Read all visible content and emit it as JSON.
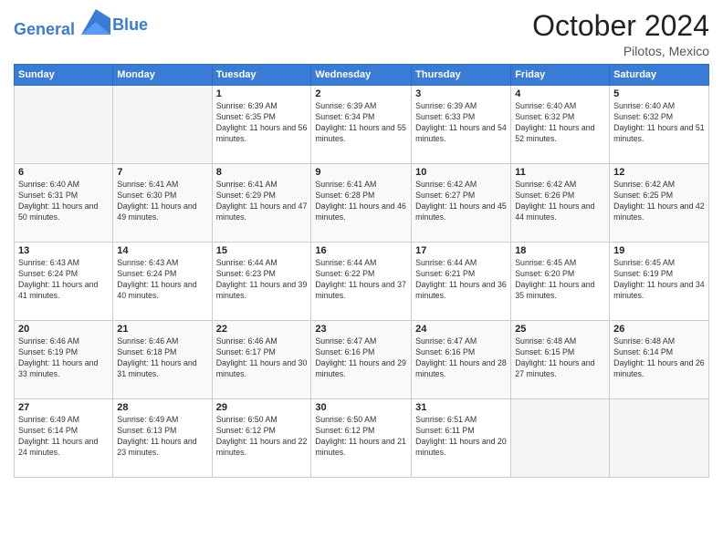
{
  "header": {
    "logo_line1": "General",
    "logo_line2": "Blue",
    "month": "October 2024",
    "location": "Pilotos, Mexico"
  },
  "weekdays": [
    "Sunday",
    "Monday",
    "Tuesday",
    "Wednesday",
    "Thursday",
    "Friday",
    "Saturday"
  ],
  "weeks": [
    [
      {
        "day": "",
        "info": ""
      },
      {
        "day": "",
        "info": ""
      },
      {
        "day": "1",
        "info": "Sunrise: 6:39 AM\nSunset: 6:35 PM\nDaylight: 11 hours and 56 minutes."
      },
      {
        "day": "2",
        "info": "Sunrise: 6:39 AM\nSunset: 6:34 PM\nDaylight: 11 hours and 55 minutes."
      },
      {
        "day": "3",
        "info": "Sunrise: 6:39 AM\nSunset: 6:33 PM\nDaylight: 11 hours and 54 minutes."
      },
      {
        "day": "4",
        "info": "Sunrise: 6:40 AM\nSunset: 6:32 PM\nDaylight: 11 hours and 52 minutes."
      },
      {
        "day": "5",
        "info": "Sunrise: 6:40 AM\nSunset: 6:32 PM\nDaylight: 11 hours and 51 minutes."
      }
    ],
    [
      {
        "day": "6",
        "info": "Sunrise: 6:40 AM\nSunset: 6:31 PM\nDaylight: 11 hours and 50 minutes."
      },
      {
        "day": "7",
        "info": "Sunrise: 6:41 AM\nSunset: 6:30 PM\nDaylight: 11 hours and 49 minutes."
      },
      {
        "day": "8",
        "info": "Sunrise: 6:41 AM\nSunset: 6:29 PM\nDaylight: 11 hours and 47 minutes."
      },
      {
        "day": "9",
        "info": "Sunrise: 6:41 AM\nSunset: 6:28 PM\nDaylight: 11 hours and 46 minutes."
      },
      {
        "day": "10",
        "info": "Sunrise: 6:42 AM\nSunset: 6:27 PM\nDaylight: 11 hours and 45 minutes."
      },
      {
        "day": "11",
        "info": "Sunrise: 6:42 AM\nSunset: 6:26 PM\nDaylight: 11 hours and 44 minutes."
      },
      {
        "day": "12",
        "info": "Sunrise: 6:42 AM\nSunset: 6:25 PM\nDaylight: 11 hours and 42 minutes."
      }
    ],
    [
      {
        "day": "13",
        "info": "Sunrise: 6:43 AM\nSunset: 6:24 PM\nDaylight: 11 hours and 41 minutes."
      },
      {
        "day": "14",
        "info": "Sunrise: 6:43 AM\nSunset: 6:24 PM\nDaylight: 11 hours and 40 minutes."
      },
      {
        "day": "15",
        "info": "Sunrise: 6:44 AM\nSunset: 6:23 PM\nDaylight: 11 hours and 39 minutes."
      },
      {
        "day": "16",
        "info": "Sunrise: 6:44 AM\nSunset: 6:22 PM\nDaylight: 11 hours and 37 minutes."
      },
      {
        "day": "17",
        "info": "Sunrise: 6:44 AM\nSunset: 6:21 PM\nDaylight: 11 hours and 36 minutes."
      },
      {
        "day": "18",
        "info": "Sunrise: 6:45 AM\nSunset: 6:20 PM\nDaylight: 11 hours and 35 minutes."
      },
      {
        "day": "19",
        "info": "Sunrise: 6:45 AM\nSunset: 6:19 PM\nDaylight: 11 hours and 34 minutes."
      }
    ],
    [
      {
        "day": "20",
        "info": "Sunrise: 6:46 AM\nSunset: 6:19 PM\nDaylight: 11 hours and 33 minutes."
      },
      {
        "day": "21",
        "info": "Sunrise: 6:46 AM\nSunset: 6:18 PM\nDaylight: 11 hours and 31 minutes."
      },
      {
        "day": "22",
        "info": "Sunrise: 6:46 AM\nSunset: 6:17 PM\nDaylight: 11 hours and 30 minutes."
      },
      {
        "day": "23",
        "info": "Sunrise: 6:47 AM\nSunset: 6:16 PM\nDaylight: 11 hours and 29 minutes."
      },
      {
        "day": "24",
        "info": "Sunrise: 6:47 AM\nSunset: 6:16 PM\nDaylight: 11 hours and 28 minutes."
      },
      {
        "day": "25",
        "info": "Sunrise: 6:48 AM\nSunset: 6:15 PM\nDaylight: 11 hours and 27 minutes."
      },
      {
        "day": "26",
        "info": "Sunrise: 6:48 AM\nSunset: 6:14 PM\nDaylight: 11 hours and 26 minutes."
      }
    ],
    [
      {
        "day": "27",
        "info": "Sunrise: 6:49 AM\nSunset: 6:14 PM\nDaylight: 11 hours and 24 minutes."
      },
      {
        "day": "28",
        "info": "Sunrise: 6:49 AM\nSunset: 6:13 PM\nDaylight: 11 hours and 23 minutes."
      },
      {
        "day": "29",
        "info": "Sunrise: 6:50 AM\nSunset: 6:12 PM\nDaylight: 11 hours and 22 minutes."
      },
      {
        "day": "30",
        "info": "Sunrise: 6:50 AM\nSunset: 6:12 PM\nDaylight: 11 hours and 21 minutes."
      },
      {
        "day": "31",
        "info": "Sunrise: 6:51 AM\nSunset: 6:11 PM\nDaylight: 11 hours and 20 minutes."
      },
      {
        "day": "",
        "info": ""
      },
      {
        "day": "",
        "info": ""
      }
    ]
  ]
}
